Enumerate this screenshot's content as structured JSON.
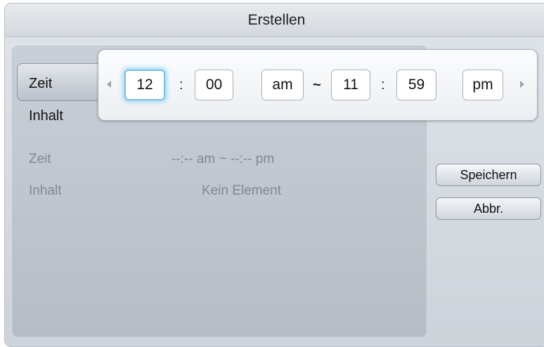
{
  "dialog": {
    "title": "Erstellen"
  },
  "menu": {
    "zeit": "Zeit",
    "inhalt": "Inhalt"
  },
  "info": {
    "zeit_label": "Zeit",
    "zeit_value": "--:-- am ~ --:-- pm",
    "inhalt_label": "Inhalt",
    "inhalt_value": "Kein Element"
  },
  "time_picker": {
    "start_hour": "12",
    "start_minute": "00",
    "start_ampm": "am",
    "range_separator": "~",
    "end_hour": "11",
    "end_minute": "59",
    "end_ampm": "pm",
    "colon": ":"
  },
  "buttons": {
    "save": "Speichern",
    "cancel": "Abbr."
  },
  "colors": {
    "focus_glow": "#7bbde6",
    "background": "#cdd3da"
  }
}
